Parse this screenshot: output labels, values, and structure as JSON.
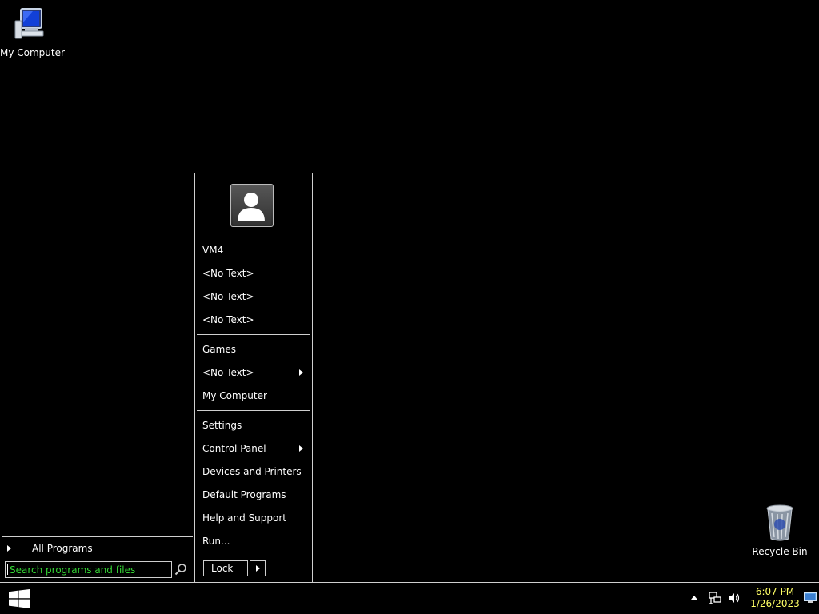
{
  "desktop": {
    "icons": [
      {
        "label": "My Computer",
        "icon": "computer-icon"
      },
      {
        "label": "Recycle Bin",
        "icon": "recycle-bin-icon"
      }
    ]
  },
  "start_menu": {
    "all_programs": "All Programs",
    "search_placeholder": "Search programs and files",
    "user": {
      "name": "VM4"
    },
    "items": [
      {
        "label": "VM4"
      },
      {
        "label": "<No Text>"
      },
      {
        "label": "<No Text>"
      },
      {
        "label": "<No Text>"
      },
      {
        "label": "Games"
      },
      {
        "label": "<No Text>",
        "submenu": true
      },
      {
        "label": "My Computer"
      },
      {
        "label": "Settings"
      },
      {
        "label": "Control Panel",
        "submenu": true
      },
      {
        "label": "Devices and Printers"
      },
      {
        "label": "Default Programs"
      },
      {
        "label": "Help and Support"
      },
      {
        "label": "Run..."
      }
    ],
    "lock_label": "Lock"
  },
  "taskbar": {
    "time": "6:07 PM",
    "date": "1/26/2023",
    "tray_icons": [
      "show-hidden-icons-arrow",
      "network-icon",
      "volume-icon"
    ]
  },
  "colors": {
    "background": "#000000",
    "border": "#cfcfcf",
    "search_text": "#35d535",
    "clock_text": "#ffff66"
  }
}
